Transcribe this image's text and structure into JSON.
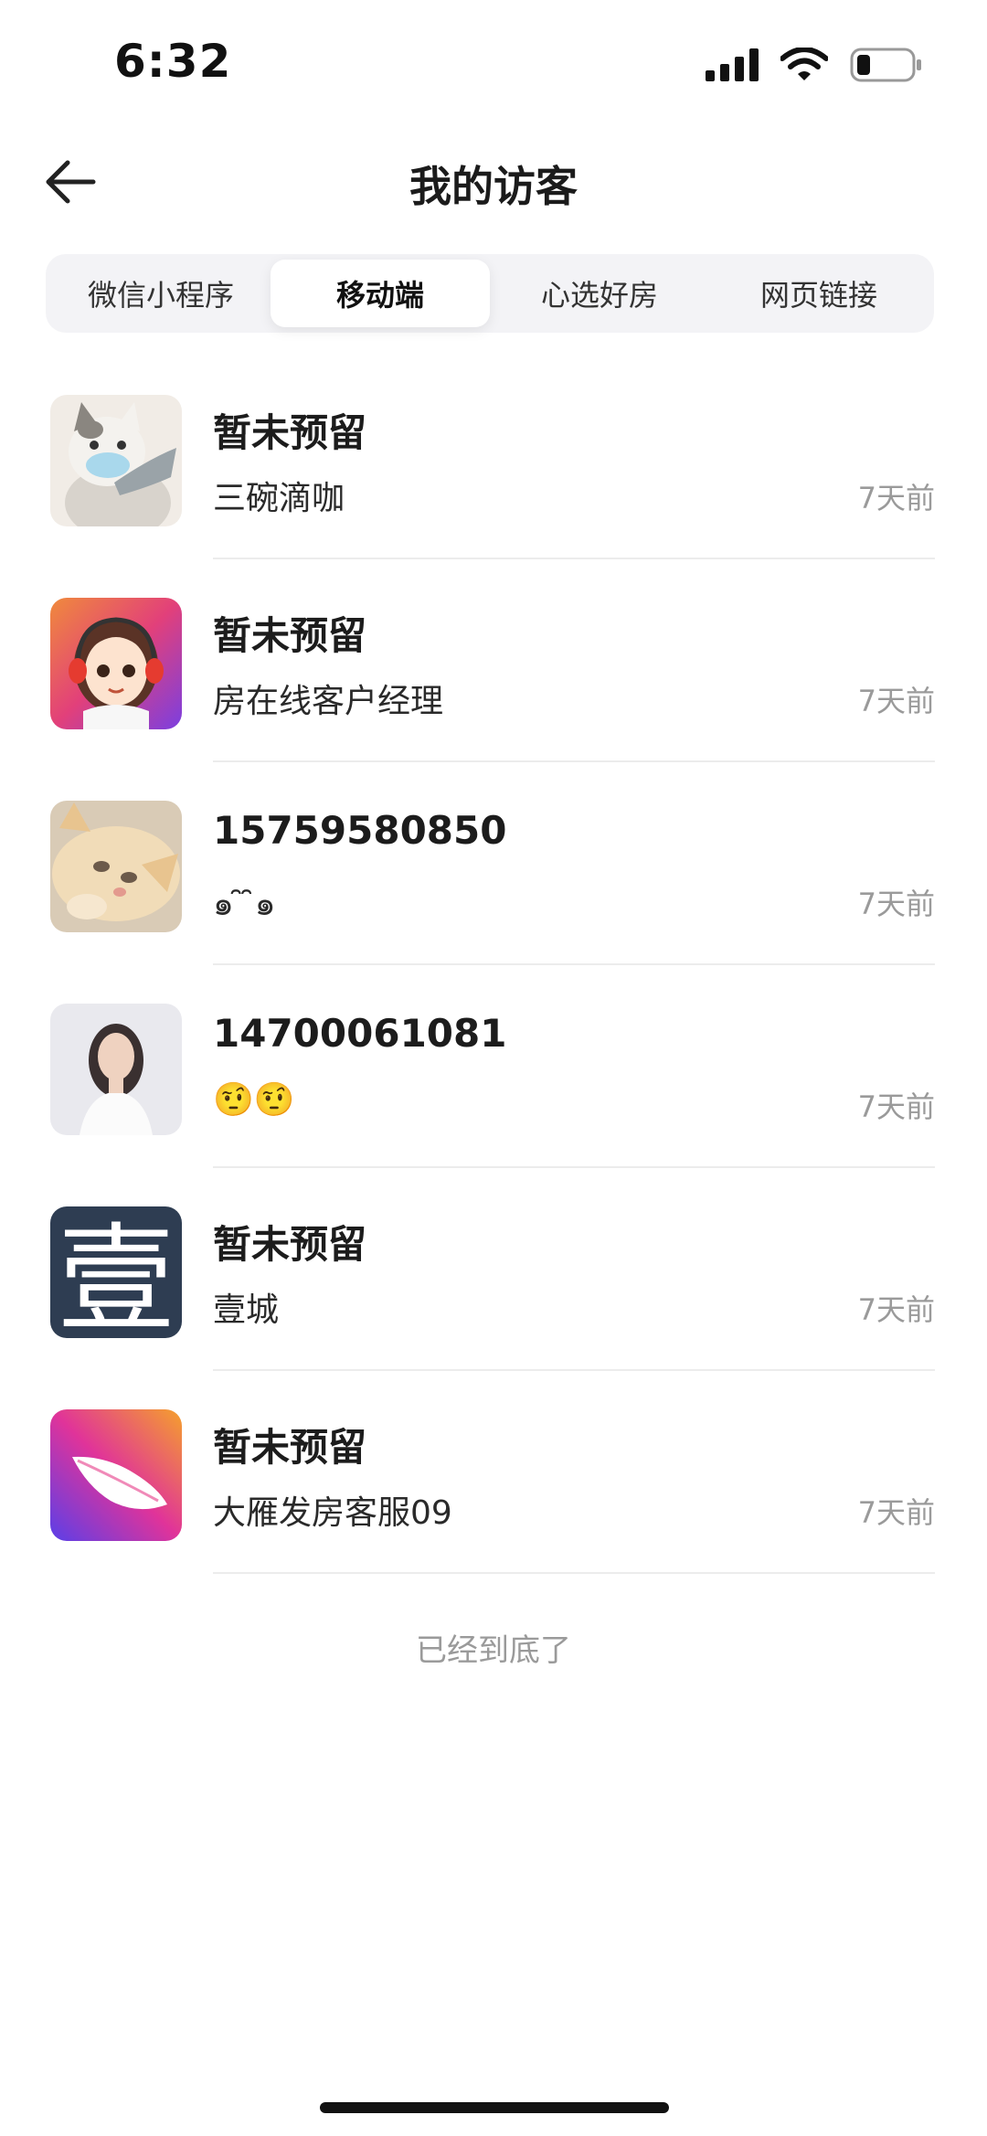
{
  "status_bar": {
    "time": "6:32",
    "icons": [
      "signal-icon",
      "wifi-icon",
      "battery-icon"
    ]
  },
  "header": {
    "title": "我的访客",
    "back_icon": "arrow-left-icon"
  },
  "tabs": [
    {
      "label": "微信小程序",
      "active": false
    },
    {
      "label": "移动端",
      "active": true
    },
    {
      "label": "心选好房",
      "active": false
    },
    {
      "label": "网页链接",
      "active": false
    }
  ],
  "visitors": [
    {
      "name": "暂未预留",
      "sub": "三碗滴咖",
      "time": "7天前",
      "avatar": "cat-with-mask-avatar"
    },
    {
      "name": "暂未预留",
      "sub": "房在线客户经理",
      "time": "7天前",
      "avatar": "cartoon-girl-headset-avatar"
    },
    {
      "name": "15759580850",
      "sub": "๑ ̑ ̑๑",
      "time": "7天前",
      "avatar": "sleeping-cat-avatar"
    },
    {
      "name": "14700061081",
      "sub": "🤨🤨",
      "time": "7天前",
      "avatar": "woman-portrait-avatar"
    },
    {
      "name": "暂未预留",
      "sub": "壹城",
      "time": "7天前",
      "avatar": "yi-character-avatar",
      "avatar_text": "壹"
    },
    {
      "name": "暂未预留",
      "sub": "大雁发房客服09",
      "time": "7天前",
      "avatar": "feather-logo-avatar"
    }
  ],
  "footer": {
    "end_text": "已经到底了"
  },
  "colors": {
    "tab_bg": "#f3f3f6",
    "time_gray": "#9a9a9a",
    "divider": "#ececec"
  }
}
